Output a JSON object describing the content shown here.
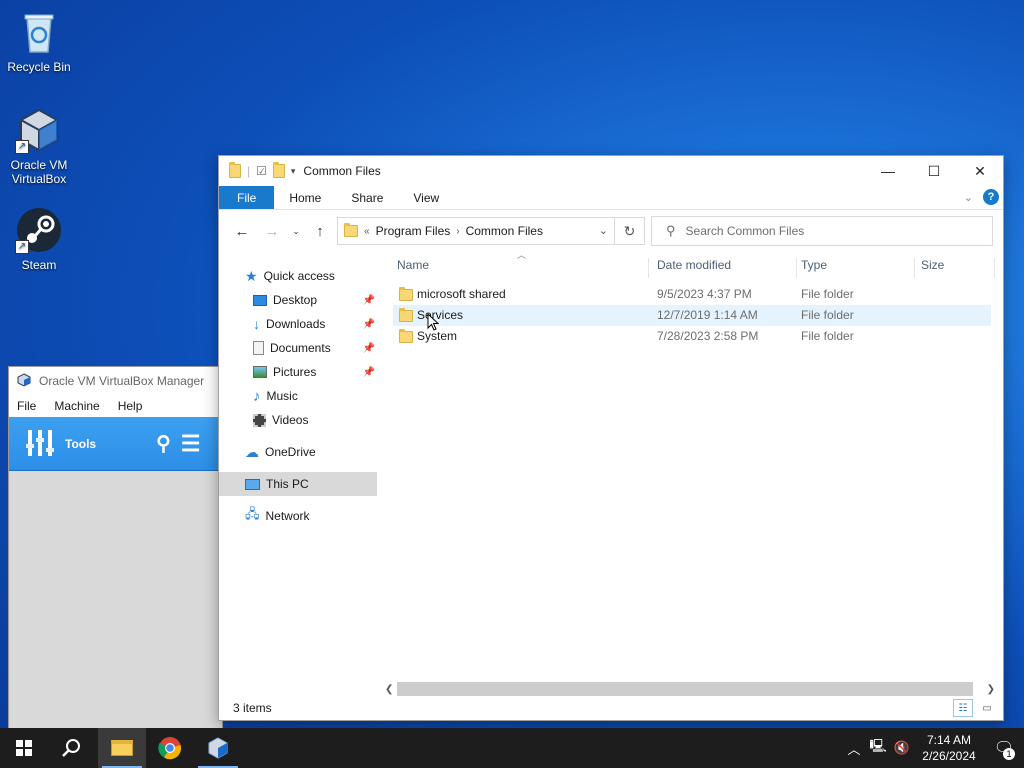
{
  "desktop": {
    "icons": [
      {
        "label": "Recycle Bin",
        "icon": "recycle-bin-icon"
      },
      {
        "label": "Oracle VM VirtualBox",
        "icon": "virtualbox-icon"
      },
      {
        "label": "Steam",
        "icon": "steam-icon"
      }
    ]
  },
  "vbox": {
    "title": "Oracle VM VirtualBox Manager",
    "menu": [
      "File",
      "Machine",
      "Help"
    ],
    "tools_label": "Tools"
  },
  "explorer": {
    "title": "Common Files",
    "ribbon": {
      "tabs": [
        "File",
        "Home",
        "Share",
        "View"
      ]
    },
    "address": {
      "prefix": "«",
      "segments": [
        "Program Files",
        "Common Files"
      ]
    },
    "search": {
      "placeholder": "Search Common Files"
    },
    "nav": {
      "quick_access": "Quick access",
      "items": [
        "Desktop",
        "Downloads",
        "Documents",
        "Pictures",
        "Music",
        "Videos"
      ],
      "onedrive": "OneDrive",
      "this_pc": "This PC",
      "network": "Network"
    },
    "columns": [
      "Name",
      "Date modified",
      "Type",
      "Size"
    ],
    "rows": [
      {
        "name": "microsoft shared",
        "date": "9/5/2023 4:37 PM",
        "type": "File folder",
        "size": ""
      },
      {
        "name": "Services",
        "date": "12/7/2019 1:14 AM",
        "type": "File folder",
        "size": ""
      },
      {
        "name": "System",
        "date": "7/28/2023 2:58 PM",
        "type": "File folder",
        "size": ""
      }
    ],
    "status": "3 items"
  },
  "taskbar": {
    "clock_time": "7:14 AM",
    "clock_date": "2/26/2024",
    "notification_count": "1"
  },
  "colors": {
    "accent": "#1979ca",
    "folder": "#f8d775",
    "taskbar": "#1d1d1d"
  }
}
